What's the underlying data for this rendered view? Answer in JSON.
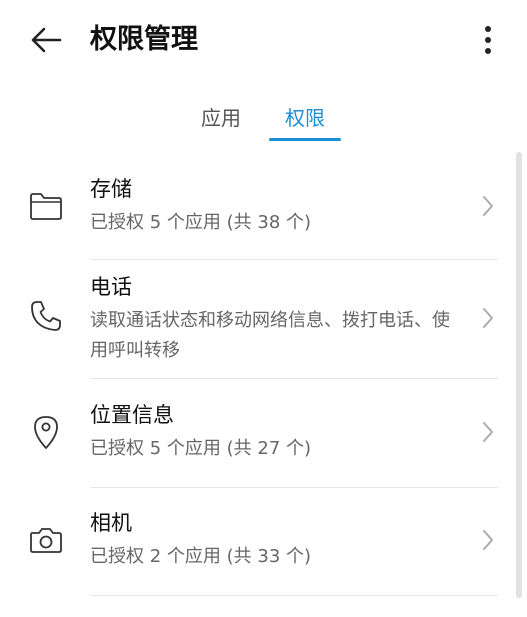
{
  "header": {
    "title": "权限管理",
    "back_icon": "arrow-left-icon",
    "more_icon": "more-vertical-icon"
  },
  "tabs": [
    {
      "label": "应用",
      "active": false
    },
    {
      "label": "权限",
      "active": true
    }
  ],
  "colors": {
    "accent": "#1a8fd6",
    "title_text": "#111111",
    "secondary_text": "#666666",
    "divider": "#e6e6e6"
  },
  "permissions": [
    {
      "title": "存储",
      "description": "已授权 5 个应用 (共 38 个)",
      "icon": "folder-icon"
    },
    {
      "title": "电话",
      "description": "读取通话状态和移动网络信息、拨打电话、使用呼叫转移",
      "icon": "phone-icon"
    },
    {
      "title": "位置信息",
      "description": "已授权 5 个应用 (共 27 个)",
      "icon": "location-pin-icon"
    },
    {
      "title": "相机",
      "description": "已授权 2 个应用 (共 33 个)",
      "icon": "camera-icon"
    }
  ]
}
